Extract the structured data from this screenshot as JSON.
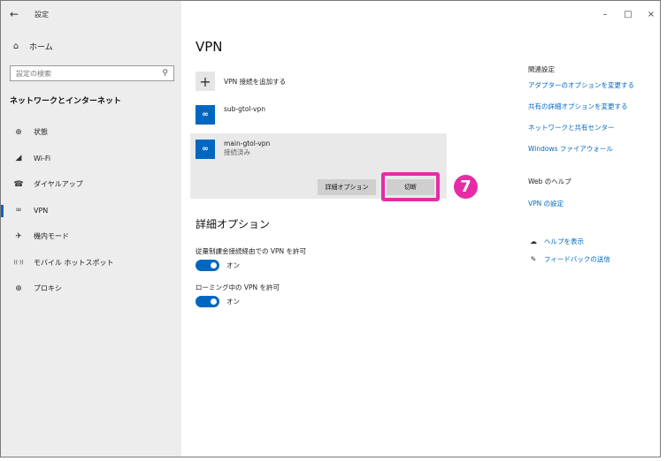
{
  "window": {
    "back_symbol": "←",
    "title": "設定",
    "controls": {
      "minimize": "–",
      "maximize": "□",
      "close": "×"
    }
  },
  "sidebar": {
    "home_label": "ホーム",
    "search_placeholder": "設定の検索",
    "section_title": "ネットワークとインターネット",
    "items": [
      {
        "label": "状態",
        "icon": "globe-status-icon",
        "glyph": "⊕"
      },
      {
        "label": "Wi-Fi",
        "icon": "wifi-icon",
        "glyph": "◢"
      },
      {
        "label": "ダイヤルアップ",
        "icon": "dialup-icon",
        "glyph": "☎"
      },
      {
        "label": "VPN",
        "icon": "vpn-icon",
        "glyph": "∞",
        "active": true
      },
      {
        "label": "機内モード",
        "icon": "airplane-icon",
        "glyph": "✈"
      },
      {
        "label": "モバイル ホットスポット",
        "icon": "hotspot-icon",
        "glyph": "((·))"
      },
      {
        "label": "プロキシ",
        "icon": "proxy-icon",
        "glyph": "⊕"
      }
    ]
  },
  "main": {
    "title": "VPN",
    "add_vpn_label": "VPN 接続を追加する",
    "connections": [
      {
        "name": "sub-gtol-vpn",
        "status": ""
      },
      {
        "name": "main-gtol-vpn",
        "status": "接続済み"
      }
    ],
    "advanced_button": "詳細オプション",
    "disconnect_button": "切断",
    "step_number": "7",
    "advanced_title": "詳細オプション",
    "options": [
      {
        "label": "従量制課金接続経由での VPN を許可",
        "state": "オン"
      },
      {
        "label": "ローミング中の VPN を許可",
        "state": "オン"
      }
    ]
  },
  "related": {
    "heading": "関連設定",
    "links": [
      "アダプターのオプションを変更する",
      "共有の詳細オプションを変更する",
      "ネットワークと共有センター",
      "Windows ファイアウォール"
    ],
    "web_help_heading": "Web のヘルプ",
    "web_help_link": "VPN の設定",
    "show_help": "ヘルプを表示",
    "feedback": "フィードバックの送信"
  },
  "colors": {
    "accent": "#0067c0",
    "highlight": "#e62ca5",
    "sidebar_bg": "#ededed"
  }
}
